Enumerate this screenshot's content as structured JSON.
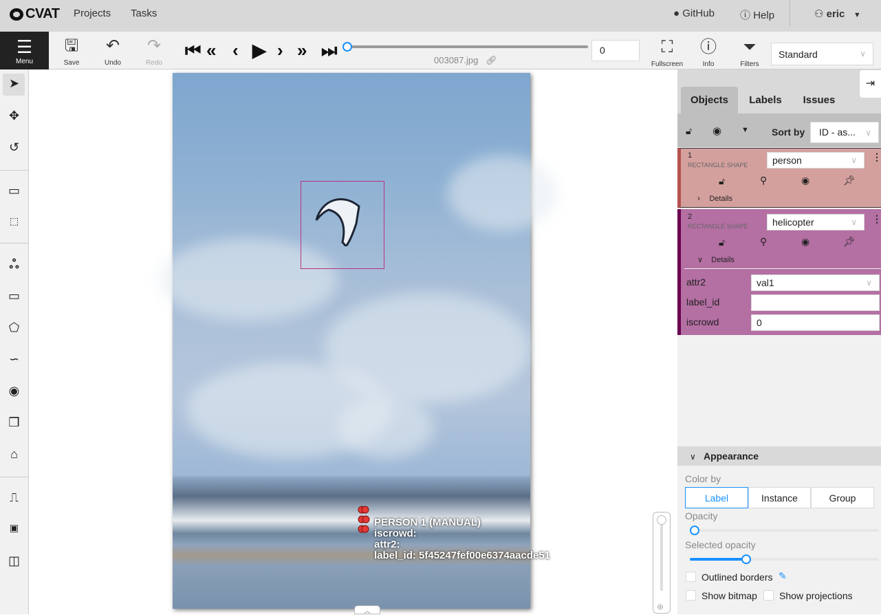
{
  "topbar": {
    "logo": "CVAT",
    "nav": [
      "Projects",
      "Tasks"
    ],
    "github": "GitHub",
    "help": "Help",
    "user": "eric"
  },
  "toolbar": {
    "menu": "Menu",
    "save": "Save",
    "undo": "Undo",
    "redo": "Redo",
    "filename": "003087.jpg",
    "frame": "0",
    "frame_progress": 0,
    "fullscreen": "Fullscreen",
    "info": "Info",
    "filters": "Filters",
    "workspace": "Standard"
  },
  "left_tools": [
    "cursor-icon",
    "move-icon",
    "rotate-icon",
    "fit-icon",
    "zoom-region-icon",
    "ai-tools-icon",
    "rectangle-icon",
    "polygon-icon",
    "polyline-icon",
    "points-icon",
    "cuboid-icon",
    "tag-icon",
    "merge-icon",
    "group-icon",
    "split-icon"
  ],
  "canvas": {
    "annotation_lines": [
      "PERSON 1 (MANUAL)",
      "iscrowd:",
      "attr2:",
      "label_id: 5f45247fef00e6374aacde51"
    ],
    "box_color": "#b5347f"
  },
  "sidebar": {
    "tabs": [
      "Objects",
      "Labels",
      "Issues"
    ],
    "sort_label": "Sort by",
    "sort_value": "ID - as...",
    "objects": [
      {
        "id": "1",
        "type": "RECTANGLE SHAPE",
        "label": "person",
        "details": "Details",
        "color": "#d4a09e",
        "accent": "#b5514f"
      },
      {
        "id": "2",
        "type": "RECTANGLE SHAPE",
        "label": "helicopter",
        "details": "Details",
        "color": "#b46fa3",
        "accent": "#6b0050",
        "attributes": [
          {
            "name": "attr2",
            "value": "val1"
          },
          {
            "name": "label_id",
            "value": ""
          },
          {
            "name": "iscrowd",
            "value": "0"
          }
        ]
      }
    ],
    "appearance": {
      "title": "Appearance",
      "color_by": "Color by",
      "options": [
        "Label",
        "Instance",
        "Group"
      ],
      "selected": "Label",
      "opacity": "Opacity",
      "opacity_value": 0,
      "selected_opacity": "Selected opacity",
      "selected_opacity_value": 30,
      "outlined": "Outlined borders",
      "show_bitmap": "Show bitmap",
      "show_projections": "Show projections"
    }
  }
}
